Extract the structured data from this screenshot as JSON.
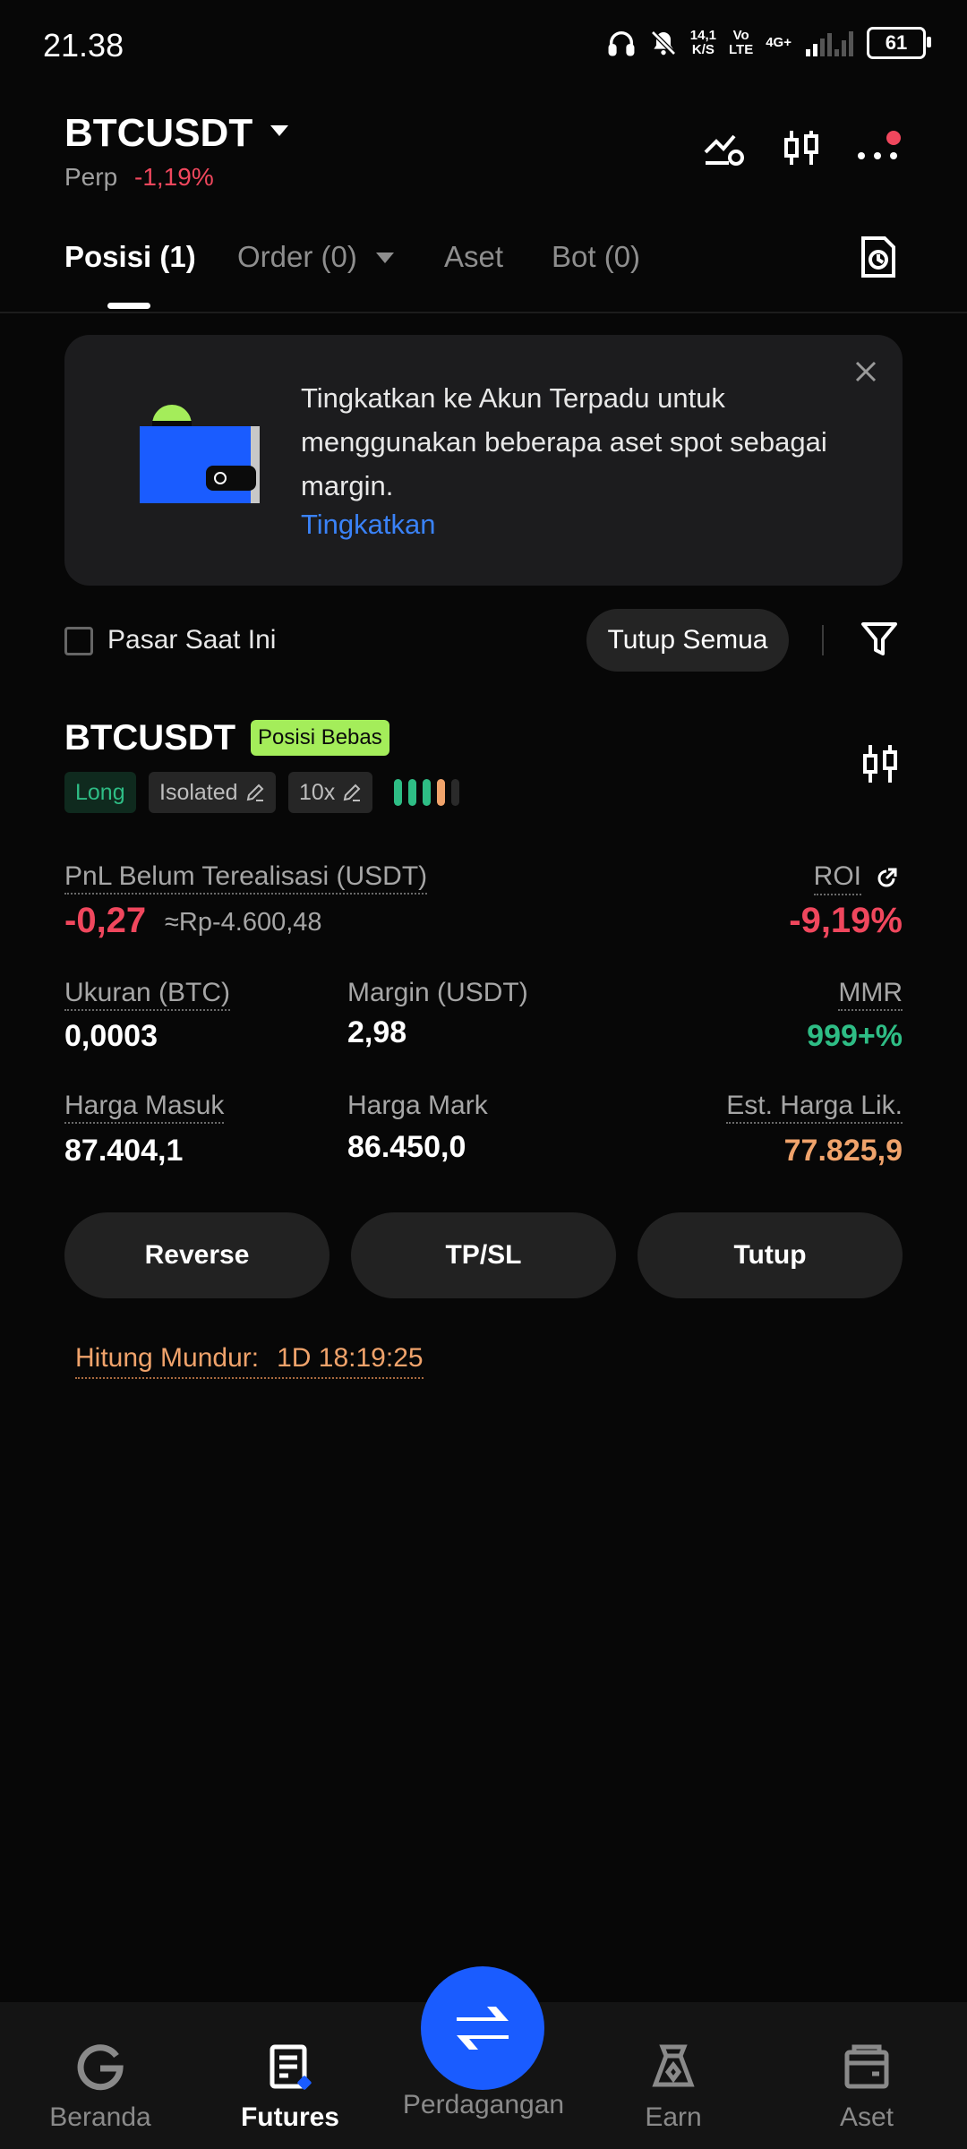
{
  "status_bar": {
    "time": "21.38",
    "net_speed_top": "14,1",
    "net_speed_bottom": "K/S",
    "volte_top": "Vo",
    "volte_bottom": "LTE",
    "signal_type": "4G+",
    "battery": "61"
  },
  "header": {
    "pair": "BTCUSDT",
    "market_type": "Perp",
    "change": "-1,19%"
  },
  "tabs": [
    {
      "label": "Posisi (1)",
      "active": true
    },
    {
      "label": "Order (0)",
      "active": false
    },
    {
      "label": "Aset",
      "active": false
    },
    {
      "label": "Bot (0)",
      "active": false
    }
  ],
  "banner": {
    "text": "Tingkatkan ke Akun Terpadu untuk menggunakan beberapa aset spot sebagai margin.",
    "link": "Tingkatkan"
  },
  "filters": {
    "checkbox_label": "Pasar Saat Ini",
    "close_all": "Tutup Semua"
  },
  "position": {
    "symbol": "BTCUSDT",
    "badge": "Posisi Bebas",
    "side": "Long",
    "margin_mode": "Isolated",
    "leverage": "10x",
    "pnl_label": "PnL Belum Terealisasi (USDT)",
    "pnl_value": "-0,27",
    "pnl_idr": "≈Rp-4.600,48",
    "roi_label": "ROI",
    "roi_value": "-9,19%",
    "size_label": "Ukuran (BTC)",
    "size_value": "0,0003",
    "margin_label": "Margin (USDT)",
    "margin_value": "2,98",
    "mmr_label": "MMR",
    "mmr_value": "999+%",
    "entry_label": "Harga Masuk",
    "entry_value": "87.404,1",
    "mark_label": "Harga Mark",
    "mark_value": "86.450,0",
    "liq_label": "Est. Harga Lik.",
    "liq_value": "77.825,9",
    "risk_level": 4
  },
  "actions": {
    "reverse": "Reverse",
    "tpsl": "TP/SL",
    "close": "Tutup"
  },
  "countdown": {
    "label": "Hitung Mundur:",
    "value": "1D 18:19:25"
  },
  "bottom_nav": [
    {
      "label": "Beranda",
      "icon": "home-icon"
    },
    {
      "label": "Futures",
      "icon": "futures-icon"
    },
    {
      "label": "Perdagangan",
      "icon": "trade-swap-icon"
    },
    {
      "label": "Earn",
      "icon": "earn-icon"
    },
    {
      "label": "Aset",
      "icon": "wallet-icon"
    }
  ],
  "colors": {
    "red": "#f0475d",
    "green": "#2ebd85",
    "orange": "#f0a36b",
    "blue": "#1a5cff",
    "link": "#3a82f7",
    "badge": "#a4ed5a"
  }
}
